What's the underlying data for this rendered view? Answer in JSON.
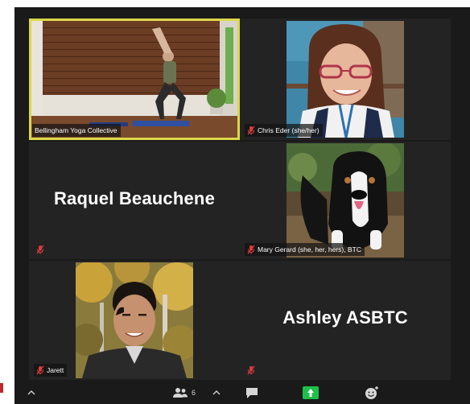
{
  "participants": [
    {
      "name": "Bellingham Yoga Collective",
      "video": "yoga-studio",
      "active": true,
      "muted": false
    },
    {
      "name": "Chris Eder (she/her)",
      "video": "woman-glasses",
      "muted": true
    },
    {
      "name": "Raquel Beauchene",
      "video": "off",
      "muted": true
    },
    {
      "name": "Mary Gerard (she, her, hers), BTC",
      "video": "dog",
      "muted": true
    },
    {
      "name": "Jarett",
      "video": "man-autumn",
      "muted": true
    },
    {
      "name": "Ashley ASBTC",
      "video": "off",
      "muted": true
    }
  ],
  "toolbar": {
    "participants_count": "6"
  },
  "icons": {
    "muted": "mic-muted-icon",
    "participants": "participants-icon",
    "chat": "chat-icon",
    "share": "share-screen-icon",
    "reactions": "reactions-icon",
    "chevron": "chevron-up-icon"
  },
  "colors": {
    "active_border": "#dcd74a",
    "muted_red": "#e03b3b",
    "share_green": "#1fbf4a",
    "tile_bg": "#232323"
  }
}
